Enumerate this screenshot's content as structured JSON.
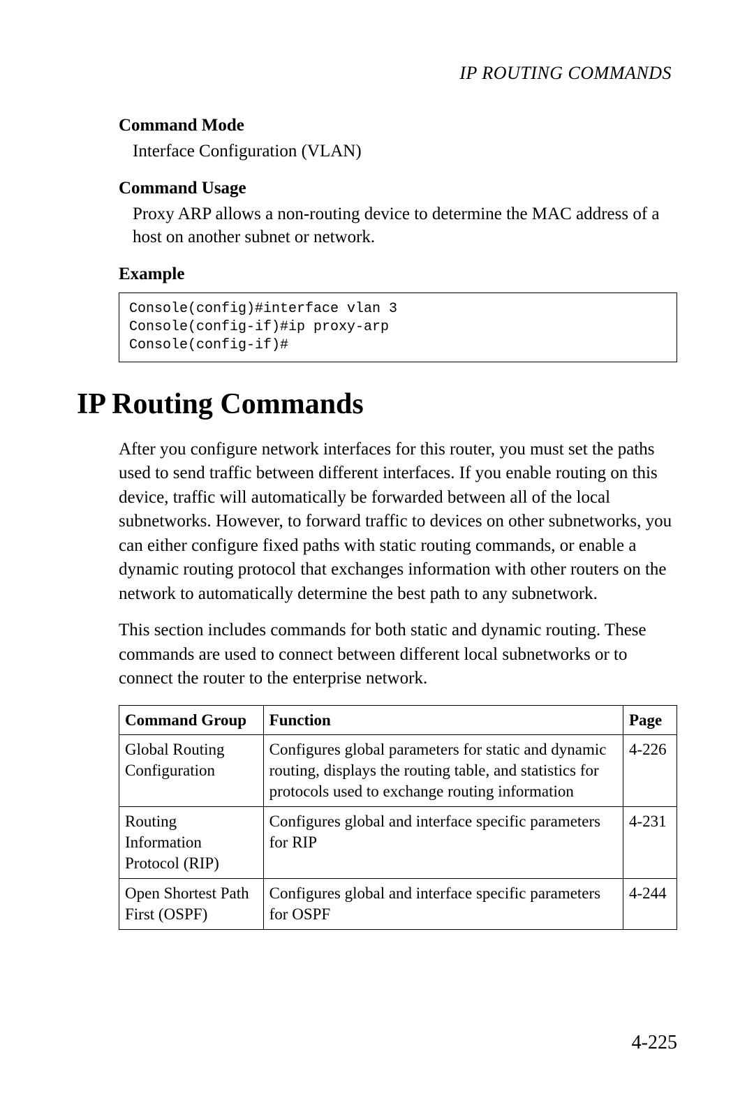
{
  "running_head": "IP ROUTING COMMANDS",
  "sections": {
    "command_mode": {
      "heading": "Command Mode",
      "text": "Interface Configuration (VLAN)"
    },
    "command_usage": {
      "heading": "Command Usage",
      "text": "Proxy ARP allows a non-routing device to determine the MAC address of a host on another subnet or network."
    },
    "example": {
      "heading": "Example",
      "code": "Console(config)#interface vlan 3\nConsole(config-if)#ip proxy-arp\nConsole(config-if)#"
    }
  },
  "title": "IP Routing Commands",
  "intro_p1": "After you configure network interfaces for this router, you must set the paths used to send traffic between different interfaces. If you enable routing on this device, traffic will automatically be forwarded between all of the local subnetworks. However, to forward traffic to devices on other subnetworks, you can either configure fixed paths with static routing commands, or enable a dynamic routing protocol that exchanges information with other routers on the network to automatically determine the best path to any subnetwork.",
  "intro_p2": "This section includes commands for both static and dynamic routing. These commands are used to connect between different local subnetworks or to connect the router to the enterprise network.",
  "table": {
    "headers": {
      "group": "Command Group",
      "function": "Function",
      "page": "Page"
    },
    "rows": [
      {
        "group": "Global Routing Configuration",
        "function": "Configures global parameters for static and dynamic routing, displays the routing table, and statistics for protocols used to exchange routing information",
        "page": "4-226"
      },
      {
        "group": "Routing Information Protocol (RIP)",
        "function": "Configures global and interface specific parameters for RIP",
        "page": "4-231"
      },
      {
        "group": "Open Shortest Path First (OSPF)",
        "function": "Configures global and interface specific parameters for OSPF",
        "page": "4-244"
      }
    ]
  },
  "page_number": "4-225"
}
